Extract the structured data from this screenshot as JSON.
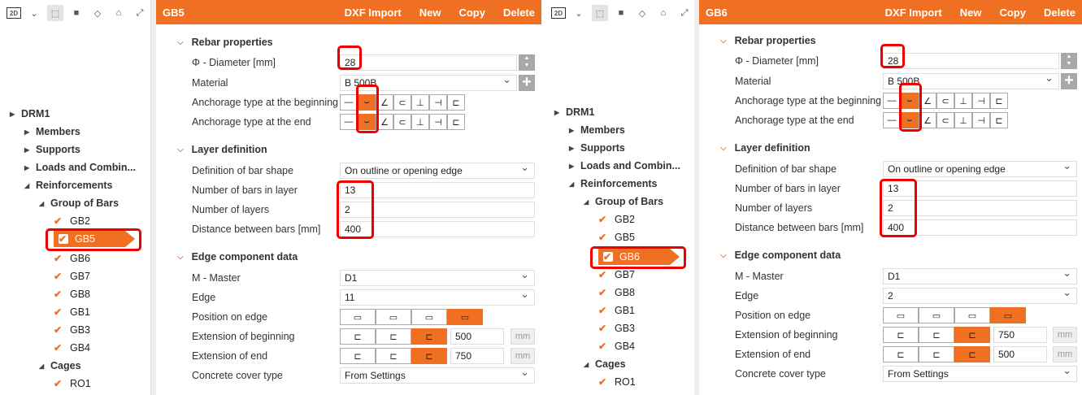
{
  "accent": "#f07023",
  "toolbar": {
    "view_mode": "2D"
  },
  "panels": [
    {
      "title": "GB5",
      "actions": [
        "DXF Import",
        "New",
        "Copy",
        "Delete"
      ],
      "tree": [
        "DRM1",
        "Members",
        "Supports",
        "Loads and Combin...",
        "Reinforcements",
        "Group of Bars",
        "GB2",
        "GB5",
        "GB6",
        "GB7",
        "GB8",
        "GB1",
        "GB3",
        "GB4",
        "Cages",
        "RO1"
      ],
      "selected": "GB5",
      "sections": {
        "rebar": "Rebar properties",
        "layer": "Layer definition",
        "edge": "Edge component data"
      },
      "labels": {
        "diameter": "Φ - Diameter [mm]",
        "material": "Material",
        "anch_begin": "Anchorage type at the beginning",
        "anch_end": "Anchorage type at the end",
        "bar_shape": "Definition of bar shape",
        "bars_in_layer": "Number of bars in layer",
        "layers": "Number of layers",
        "distance": "Distance between bars [mm]",
        "master": "M - Master",
        "edge": "Edge",
        "position": "Position on edge",
        "ext_begin": "Extension of beginning",
        "ext_end": "Extension of end",
        "cover": "Concrete cover type"
      },
      "values": {
        "diameter": "28",
        "material": "B 500B",
        "bar_shape": "On outline or opening edge",
        "bars_in_layer": "13",
        "layers": "2",
        "distance": "400",
        "master": "D1",
        "edge": "11",
        "ext_begin": "500",
        "ext_end": "750",
        "cover": "From Settings",
        "unit": "mm"
      }
    },
    {
      "title": "GB6",
      "actions": [
        "DXF Import",
        "New",
        "Copy",
        "Delete"
      ],
      "tree": [
        "DRM1",
        "Members",
        "Supports",
        "Loads and Combin...",
        "Reinforcements",
        "Group of Bars",
        "GB2",
        "GB5",
        "GB6",
        "GB7",
        "GB8",
        "GB1",
        "GB3",
        "GB4",
        "Cages",
        "RO1"
      ],
      "selected": "GB6",
      "sections": {
        "rebar": "Rebar properties",
        "layer": "Layer definition",
        "edge": "Edge component data"
      },
      "labels": {
        "diameter": "Φ - Diameter [mm]",
        "material": "Material",
        "anch_begin": "Anchorage type at the beginning",
        "anch_end": "Anchorage type at the end",
        "bar_shape": "Definition of bar shape",
        "bars_in_layer": "Number of bars in layer",
        "layers": "Number of layers",
        "distance": "Distance between bars [mm]",
        "master": "M - Master",
        "edge": "Edge",
        "position": "Position on edge",
        "ext_begin": "Extension of beginning",
        "ext_end": "Extension of end",
        "cover": "Concrete cover type"
      },
      "values": {
        "diameter": "28",
        "material": "B 500B",
        "bar_shape": "On outline or opening edge",
        "bars_in_layer": "13",
        "layers": "2",
        "distance": "400",
        "master": "D1",
        "edge": "2",
        "ext_begin": "750",
        "ext_end": "500",
        "cover": "From Settings",
        "unit": "mm"
      }
    }
  ]
}
